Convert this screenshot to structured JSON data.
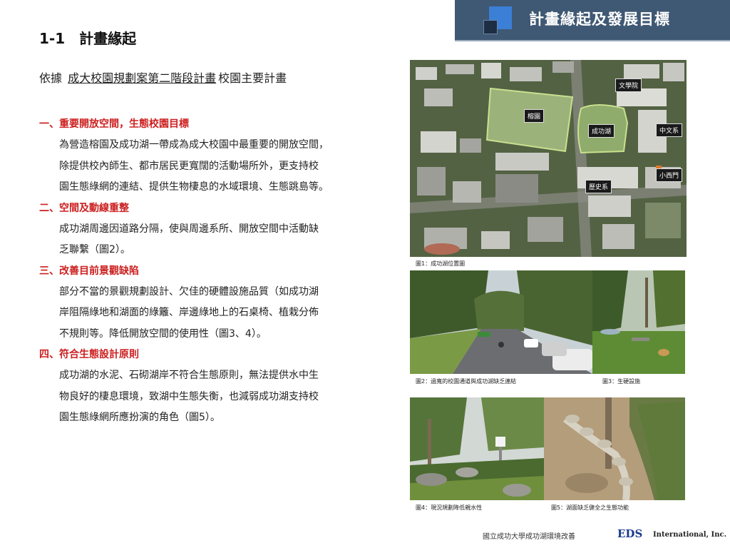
{
  "header": {
    "title": "計畫緣起及發展目標"
  },
  "section": {
    "title": "1-1　計畫緣起"
  },
  "intro": {
    "prefix": "依據",
    "underlined": "成大校園規劃案第二階段計畫",
    "suffix": "校園主要計畫"
  },
  "items": [
    {
      "heading": "一、重要開放空間，生態校園目標",
      "lines": [
        "為營造榕園及成功湖一帶成為成大校園中最重要的開放空間，",
        "除提供校內師生、都市居民更寬闊的活動場所外，更支持校",
        "園生態綠網的連結、提供生物棲息的水域環境、生態跳島等。"
      ]
    },
    {
      "heading": "二、空間及動線重整",
      "lines": [
        "成功湖周邊因道路分隔，使與周邊系所、開放空間中活動缺",
        "乏聯繫（圖2）。"
      ]
    },
    {
      "heading": "三、改善目前景觀缺陷",
      "lines": [
        "部分不當的景觀規劃設計、欠佳的硬體設施品質（如成功湖",
        "岸阻隔綠地和湖面的綠籬、岸邊綠地上的石桌椅、植栽分佈",
        "不規則等。降低開放空間的使用性（圖3、4）。"
      ]
    },
    {
      "heading": "四、符合生態設計原則",
      "lines": [
        "成功湖的水泥、石砌湖岸不符合生態原則，無法提供水中生",
        "物良好的棲息環境，致湖中生態失衡，也減弱成功湖支持校",
        "園生態綠網所應扮演的角色（圖5）。"
      ]
    }
  ],
  "map_labels": {
    "literature": "文學院",
    "banyan": "榕園",
    "lake": "成功湖",
    "chinese": "中文系",
    "west_gate": "小西門",
    "history": "歷史系"
  },
  "captions": {
    "fig1": "圖1：成功湖位置圖",
    "fig2": "圖2：過寬的校園通道與成功湖缺乏連結",
    "fig3": "圖3：生硬設施",
    "fig4": "圖4：現況規劃降低親水性",
    "fig5": "圖5：湖面缺乏健全之生態功能"
  },
  "footer": {
    "text": "國立成功大學成功湖環境改善",
    "brand": "EDS",
    "suffix": "International, Inc."
  },
  "colors": {
    "header_bg": "#3f5873",
    "accent_square": "#3b7fd6",
    "heading_red": "#cc1f1f",
    "brand_blue": "#1a3a8c"
  }
}
